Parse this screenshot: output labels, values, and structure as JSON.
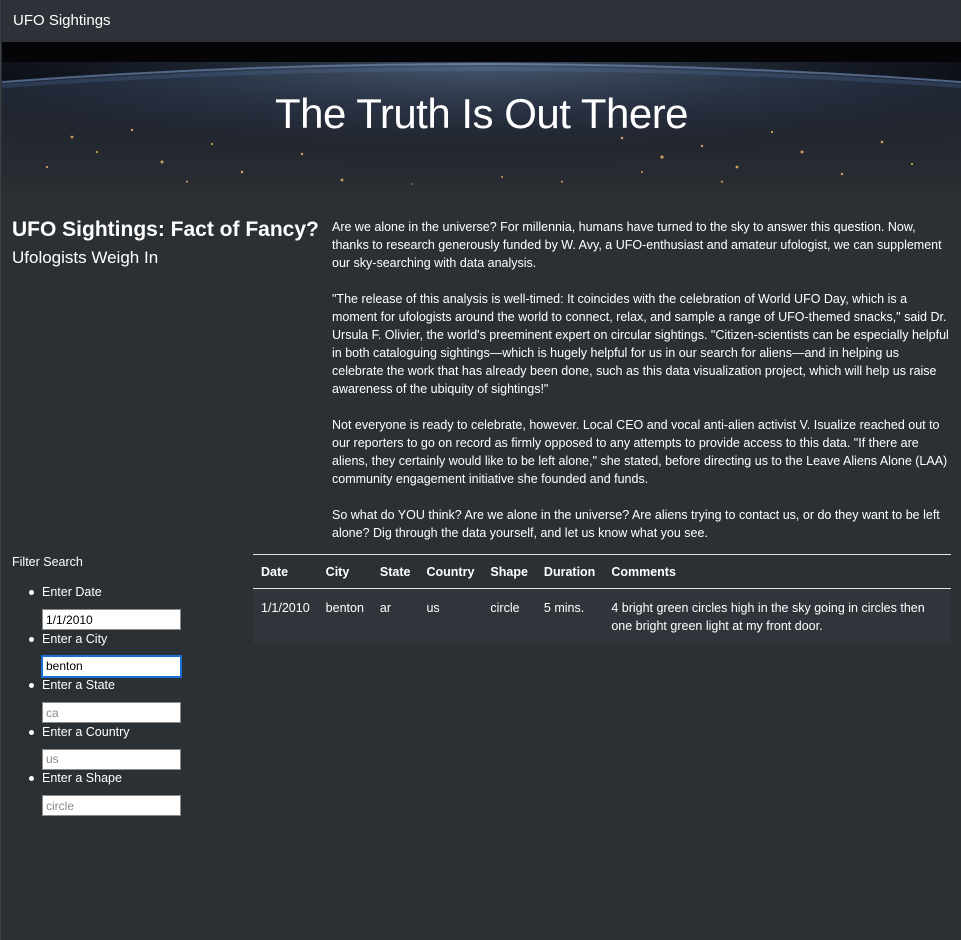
{
  "navbar": {
    "brand": "UFO Sightings"
  },
  "hero": {
    "title": "The Truth Is Out There"
  },
  "headline": {
    "title": "UFO Sightings: Fact of Fancy?",
    "subtitle": "Ufologists Weigh In"
  },
  "article": {
    "paragraphs": [
      "Are we alone in the universe? For millennia, humans have turned to the sky to answer this question. Now, thanks to research generously funded by W. Avy, a UFO-enthusiast and amateur ufologist, we can supplement our sky-searching with data analysis.",
      "\"The release of this analysis is well-timed: It coincides with the celebration of World UFO Day, which is a moment for ufologists around the world to connect, relax, and sample a range of UFO-themed snacks,\" said Dr. Ursula F. Olivier, the world's preeminent expert on circular sightings. \"Citizen-scientists can be especially helpful in both cataloguing sightings—which is hugely helpful for us in our search for aliens—and in helping us celebrate the work that has already been done, such as this data visualization project, which will help us raise awareness of the ubiquity of sightings!\"",
      "Not everyone is ready to celebrate, however. Local CEO and vocal anti-alien activist V. Isualize reached out to our reporters to go on record as firmly opposed to any attempts to provide access to this data. \"If there are aliens, they certainly would like to be left alone,\" she stated, before directing us to the Leave Aliens Alone (LAA) community engagement initiative she founded and funds.",
      "So what do YOU think? Are we alone in the universe? Are aliens trying to contact us, or do they want to be left alone? Dig through the data yourself, and let us know what you see."
    ]
  },
  "filters": {
    "title": "Filter Search",
    "items": [
      {
        "label": "Enter Date",
        "value": "1/1/2010",
        "placeholder": "1/1/2010"
      },
      {
        "label": "Enter a City",
        "value": "benton",
        "placeholder": ""
      },
      {
        "label": "Enter a State",
        "value": "",
        "placeholder": "ca"
      },
      {
        "label": "Enter a Country",
        "value": "",
        "placeholder": "us"
      },
      {
        "label": "Enter a Shape",
        "value": "",
        "placeholder": "circle"
      }
    ]
  },
  "table": {
    "headers": [
      "Date",
      "City",
      "State",
      "Country",
      "Shape",
      "Duration",
      "Comments"
    ],
    "rows": [
      [
        "1/1/2010",
        "benton",
        "ar",
        "us",
        "circle",
        "5 mins.",
        "4 bright green circles high in the sky going in circles then one bright green light at my front door."
      ]
    ]
  },
  "colors": {
    "background": "#2b3035",
    "navbar": "#2d3238",
    "focus_ring": "#1a6fd6"
  }
}
